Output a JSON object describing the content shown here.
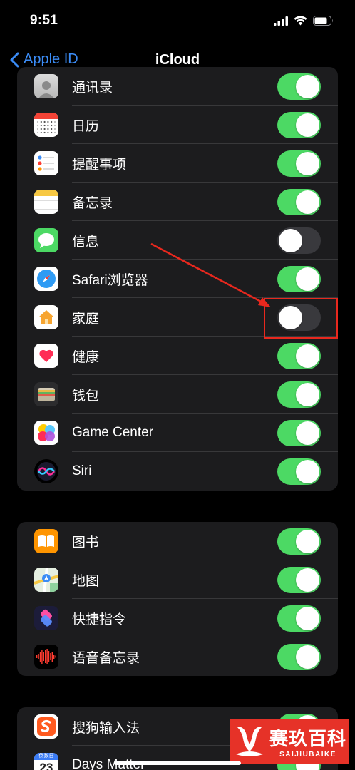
{
  "status_bar": {
    "time": "9:51"
  },
  "nav": {
    "back_label": "Apple ID",
    "title": "iCloud"
  },
  "group1": [
    {
      "label": "通讯录",
      "icon": "contacts-icon",
      "on": true
    },
    {
      "label": "日历",
      "icon": "calendar-icon",
      "on": true
    },
    {
      "label": "提醒事项",
      "icon": "reminders-icon",
      "on": true
    },
    {
      "label": "备忘录",
      "icon": "notes-icon",
      "on": true
    },
    {
      "label": "信息",
      "icon": "messages-icon",
      "on": false
    },
    {
      "label": "Safari浏览器",
      "icon": "safari-icon",
      "on": true
    },
    {
      "label": "家庭",
      "icon": "home-icon",
      "on": false
    },
    {
      "label": "健康",
      "icon": "health-icon",
      "on": true
    },
    {
      "label": "钱包",
      "icon": "wallet-icon",
      "on": true
    },
    {
      "label": "Game Center",
      "icon": "game-center-icon",
      "on": true
    },
    {
      "label": "Siri",
      "icon": "siri-icon",
      "on": true
    }
  ],
  "group2": [
    {
      "label": "图书",
      "icon": "books-icon",
      "on": true
    },
    {
      "label": "地图",
      "icon": "maps-icon",
      "on": true
    },
    {
      "label": "快捷指令",
      "icon": "shortcuts-icon",
      "on": true
    },
    {
      "label": "语音备忘录",
      "icon": "voice-memos-icon",
      "on": true
    }
  ],
  "group3": [
    {
      "label": "搜狗输入法",
      "icon": "sogou-icon",
      "on": true
    },
    {
      "label": "Days Matter",
      "icon": "days-matter-icon",
      "on": true,
      "icon_text": "23",
      "icon_caption": "倒数日"
    }
  ],
  "watermark": {
    "brand_cn": "赛玖百科",
    "brand_en": "SAIJIUBAIKE"
  },
  "colors": {
    "accent": "#3b8cf6",
    "toggle_on": "#4cd964",
    "toggle_off": "#39393d",
    "annotation": "#e8281e",
    "watermark": "#e63228"
  }
}
